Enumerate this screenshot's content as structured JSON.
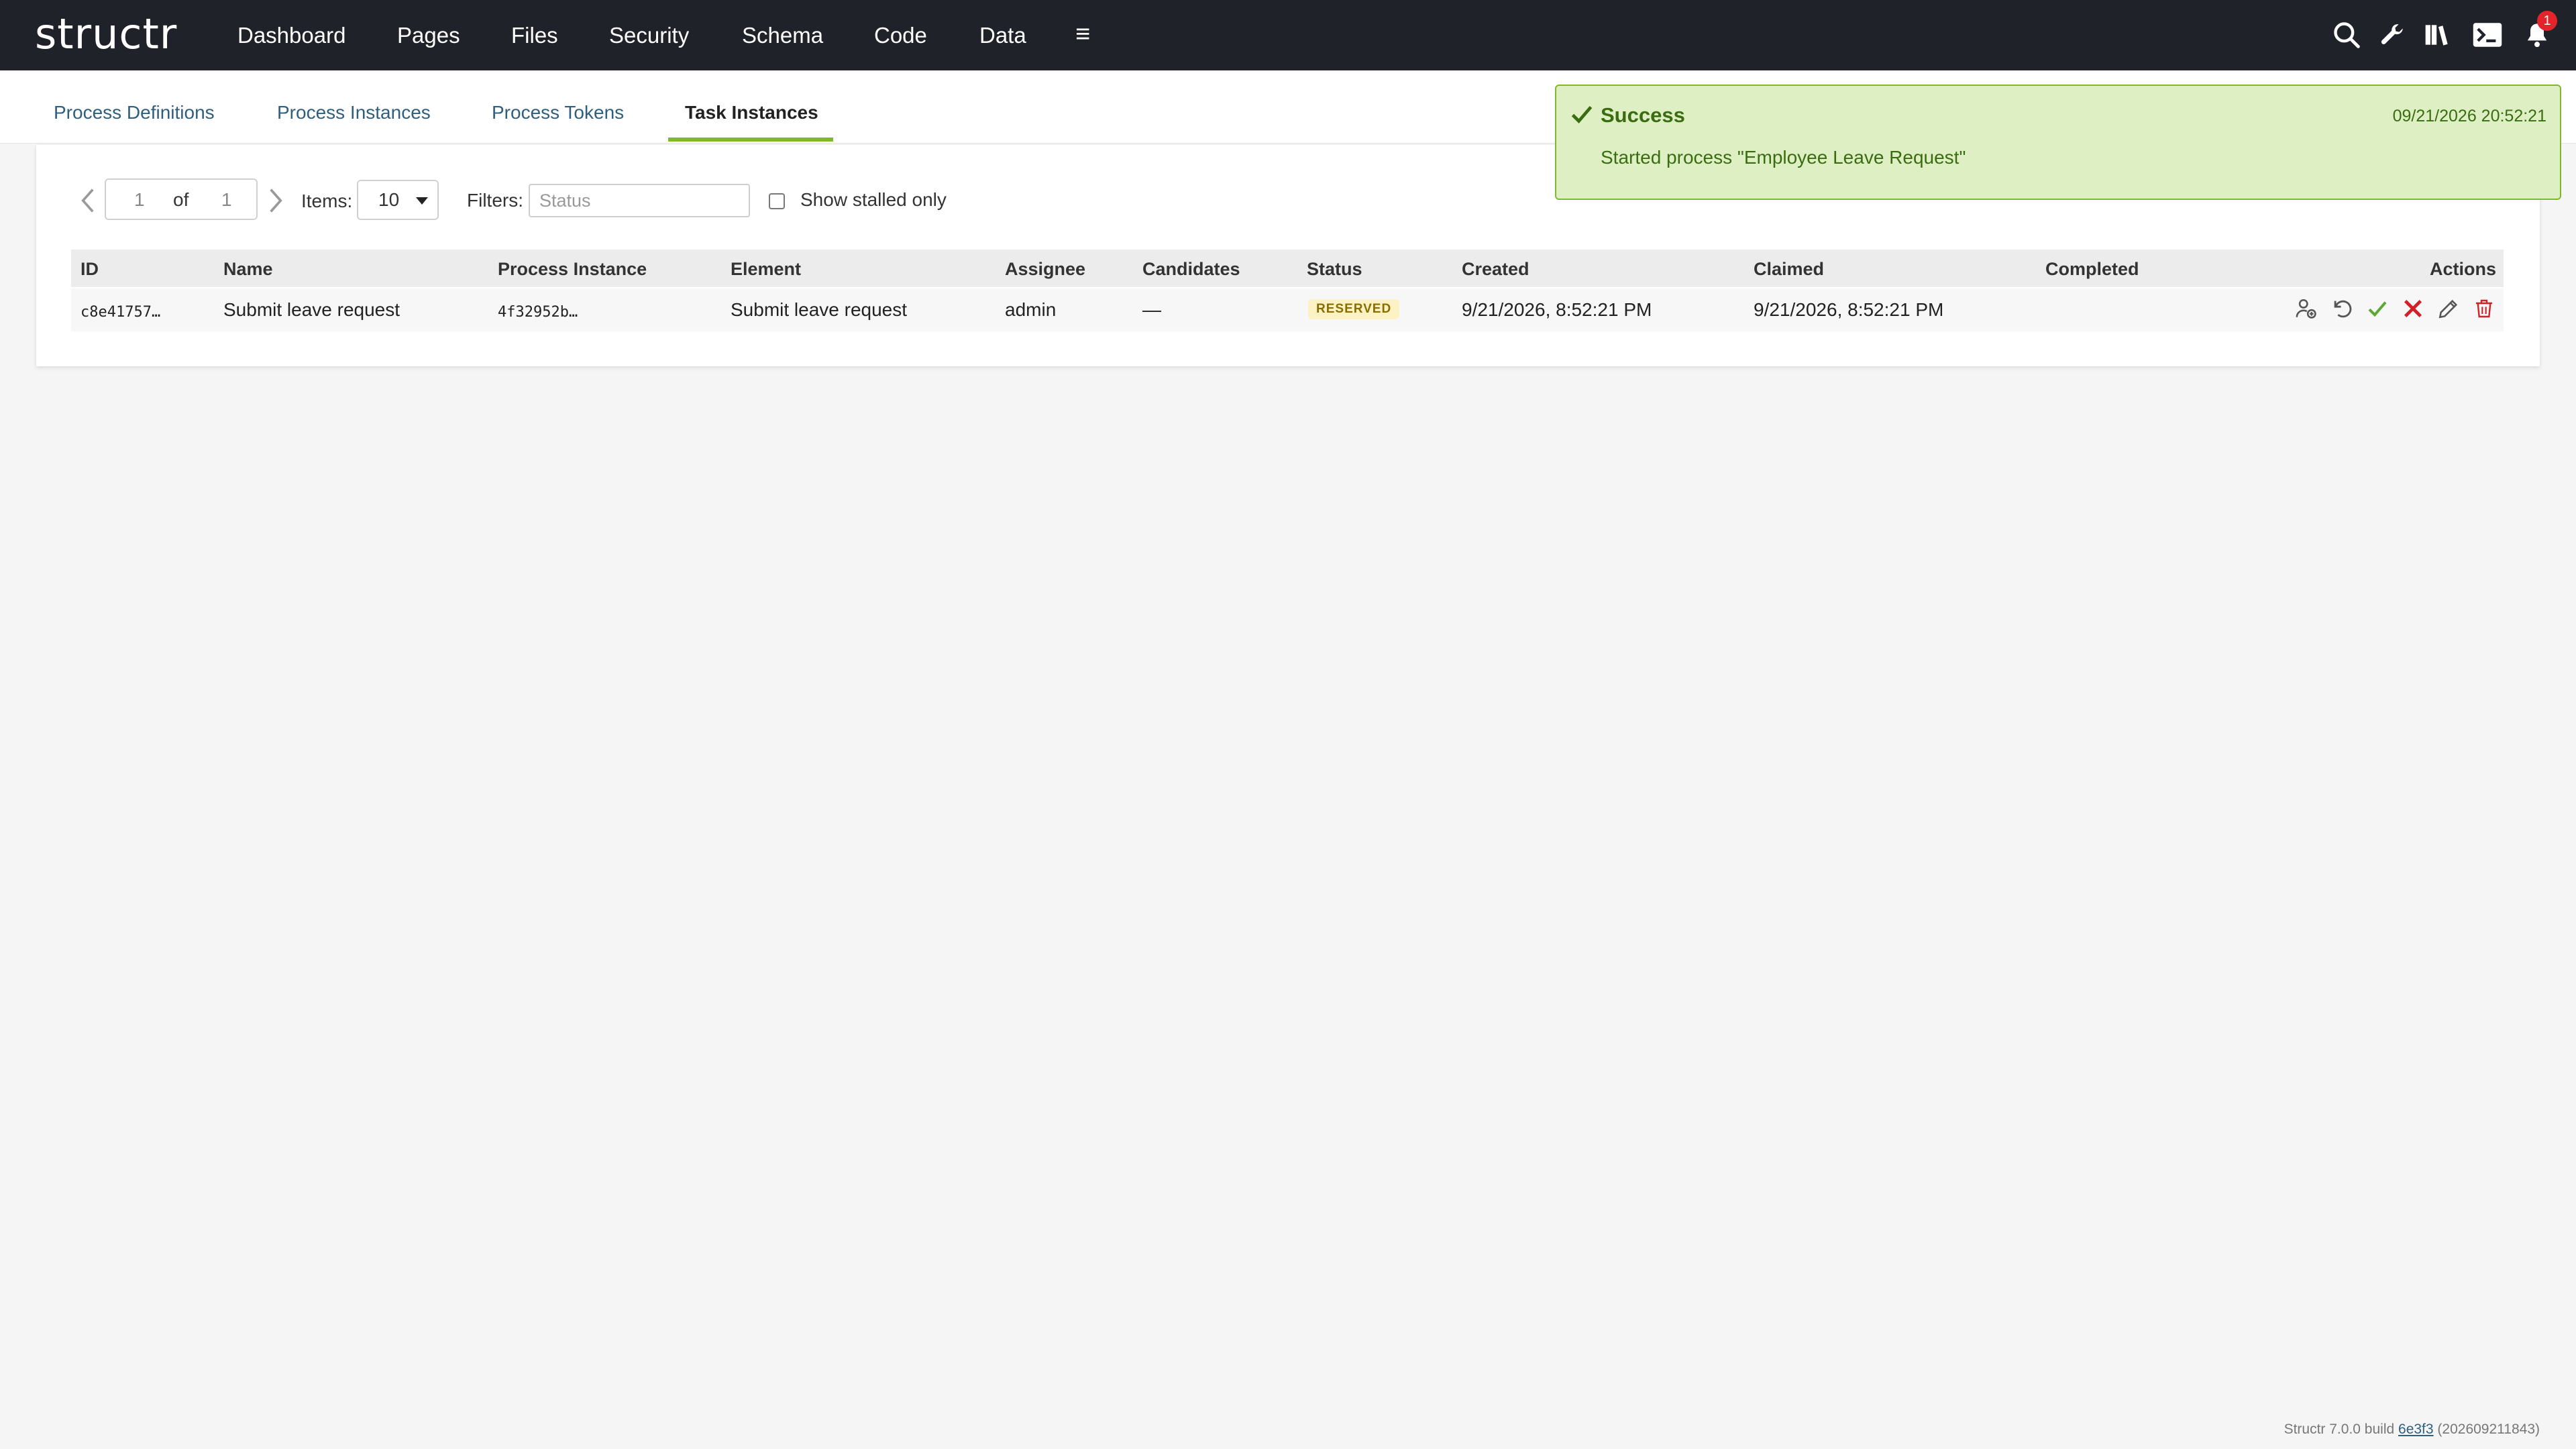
{
  "app": {
    "logo": "structr"
  },
  "nav": {
    "items": [
      "Dashboard",
      "Pages",
      "Files",
      "Security",
      "Schema",
      "Code",
      "Data"
    ],
    "menu_glyph": "≡",
    "notification_count": "1",
    "icons": [
      "search-icon",
      "wrench-icon",
      "book-icon",
      "terminal-icon",
      "bell-icon"
    ]
  },
  "subtabs": {
    "items": [
      "Process Definitions",
      "Process Instances",
      "Process Tokens",
      "Task Instances"
    ],
    "active": "Task Instances"
  },
  "pager": {
    "page": "1",
    "of_label": "of",
    "total": "1",
    "items_label": "Items:",
    "items_value": "10",
    "filters_label": "Filters:",
    "filter_placeholder": "Status",
    "stalled_label": "Show stalled only"
  },
  "table": {
    "headers": [
      "ID",
      "Name",
      "Process Instance",
      "Element",
      "Assignee",
      "Candidates",
      "Status",
      "Created",
      "Claimed",
      "Completed",
      "Actions"
    ],
    "rows": [
      {
        "id": "c8e41757…",
        "name": "Submit leave request",
        "process_instance": "4f32952b…",
        "element": "Submit leave request",
        "assignee": "admin",
        "candidates": "—",
        "status": "RESERVED",
        "created": "9/21/2026, 8:52:21 PM",
        "claimed": "9/21/2026, 8:52:21 PM",
        "completed": ""
      }
    ],
    "action_icons": [
      "assign-user-icon",
      "undo-icon",
      "complete-check-icon",
      "cancel-x-icon",
      "edit-pencil-icon",
      "delete-trash-icon"
    ]
  },
  "toast": {
    "title": "Success",
    "timestamp": "09/21/2026 20:52:21",
    "message": "Started process \"Employee Leave Request\""
  },
  "footer": {
    "prefix": "Structr 7.0.0 build",
    "build": "6e3f3",
    "suffix": "(202609211843)"
  },
  "colors": {
    "topbar": "#1f2329",
    "accent_green": "#7fb82b",
    "toast_bg": "#deefc3",
    "danger": "#e3242b"
  }
}
